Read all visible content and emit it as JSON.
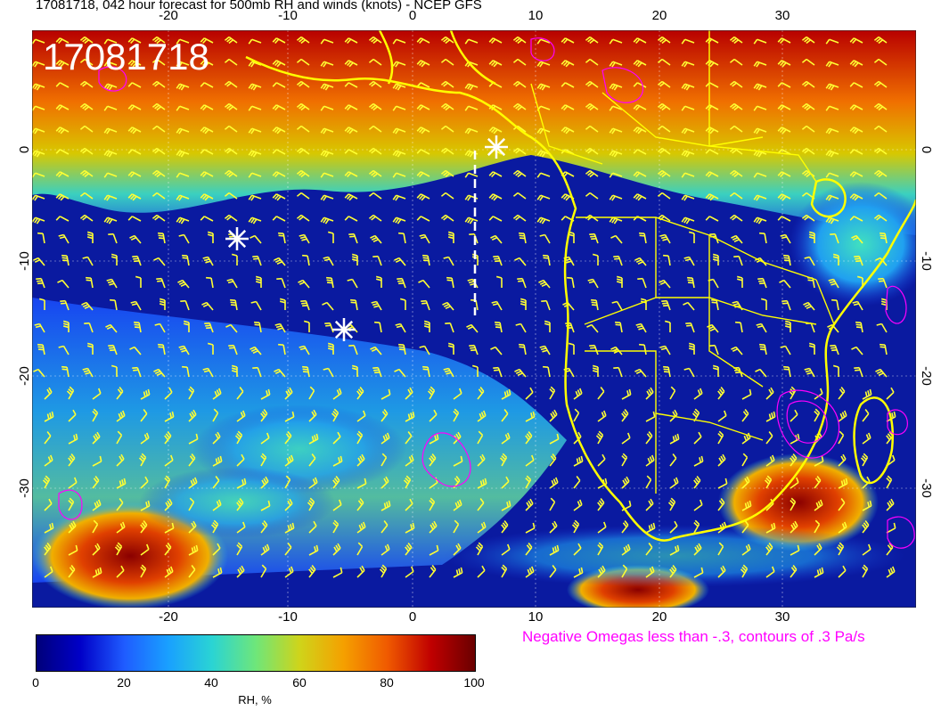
{
  "title": "17081718, 042 hour forecast for 500mb RH and winds (knots) - NCEP GFS",
  "stamp": "17081718",
  "map": {
    "lon_ticks": [
      "-20",
      "-10",
      "0",
      "10",
      "20",
      "30"
    ],
    "lat_ticks": [
      "0",
      "-10",
      "-20",
      "-30"
    ],
    "ocean_color": "#0a1aa0",
    "land_border_color": "#ffff00",
    "barb_color": "#ffff33",
    "omega_contour_color": "#ff00ff",
    "markers": [
      {
        "name": "white-asterisk-1"
      },
      {
        "name": "white-asterisk-2"
      },
      {
        "name": "white-asterisk-3"
      }
    ]
  },
  "colorbar": {
    "ticks": [
      "0",
      "20",
      "40",
      "60",
      "80",
      "100"
    ],
    "label": "RH, %"
  },
  "omega_note": "Negative Omegas less than -.3, contours of .3 Pa/s"
}
